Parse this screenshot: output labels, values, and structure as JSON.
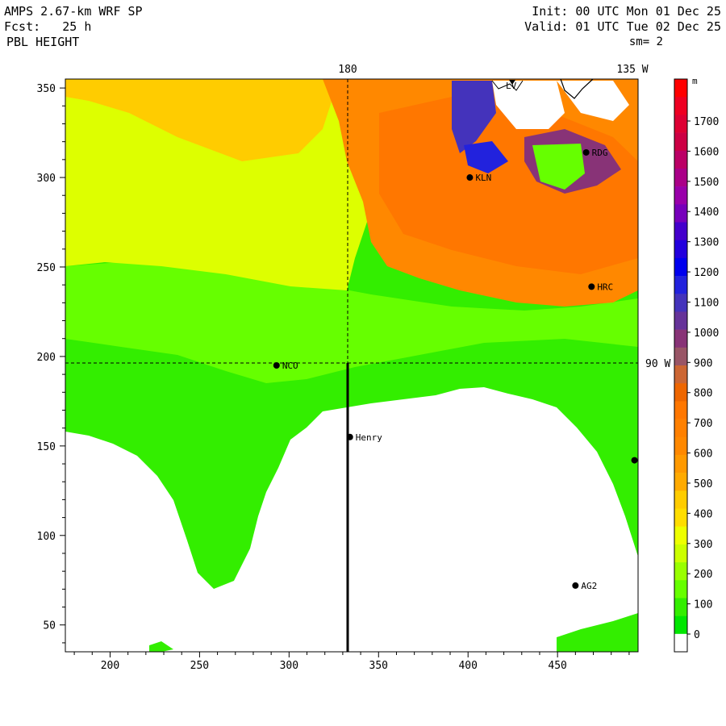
{
  "header": {
    "model": "AMPS 2.67-km WRF SP",
    "forecast": "Fcst:   25 h",
    "field": "PBL HEIGHT",
    "init": "Init: 00 UTC Mon 01 Dec 25",
    "valid": "Valid: 01 UTC Tue 02 Dec 25",
    "smoothing": "sm= 2"
  },
  "map": {
    "x_ticks": [
      "200",
      "250",
      "300",
      "350",
      "400",
      "450"
    ],
    "y_ticks": [
      "50",
      "100",
      "150",
      "200",
      "250",
      "300",
      "350"
    ],
    "meridian_labels": {
      "lon_180": "180",
      "lon_135w": "135 W",
      "lon_90w": "90 W"
    },
    "grid_x_range": [
      175,
      495
    ],
    "grid_y_range": [
      35,
      355
    ],
    "stations": [
      {
        "name": "RDG",
        "x": 466,
        "y": 314
      },
      {
        "name": "KLN",
        "x": 401,
        "y": 300
      },
      {
        "name": "HRC",
        "x": 469,
        "y": 239
      },
      {
        "name": "NCO",
        "x": 293,
        "y": 195
      },
      {
        "name": "Henry",
        "x": 334,
        "y": 155
      },
      {
        "name": "AG2",
        "x": 460,
        "y": 72
      },
      {
        "name": "",
        "x": 493,
        "y": 142
      }
    ],
    "top_marker": "LV",
    "crosshair": {
      "x": 333,
      "y": 196
    }
  },
  "colorbar": {
    "unit": "m",
    "labels": [
      "1700",
      "1600",
      "1500",
      "1400",
      "1300",
      "1200",
      "1100",
      "1000",
      "900",
      "800",
      "700",
      "600",
      "500",
      "400",
      "300",
      "200",
      "100",
      "0"
    ],
    "colors": [
      "#ff0000",
      "#ee0022",
      "#dd0033",
      "#cc0044",
      "#bb0066",
      "#aa0088",
      "#9900aa",
      "#7700bb",
      "#4400cc",
      "#2200dd",
      "#0000ee",
      "#2222dd",
      "#4433bb",
      "#663399",
      "#883377",
      "#995566",
      "#cc6633",
      "#ee6600",
      "#ff7700",
      "#ff8000",
      "#ff8800",
      "#ff9900",
      "#ffaa00",
      "#ffcc00",
      "#ffdd00",
      "#eeff00",
      "#ccff00",
      "#99ff00",
      "#66ff00",
      "#33ee00",
      "#00e600",
      "#ffffff"
    ]
  }
}
